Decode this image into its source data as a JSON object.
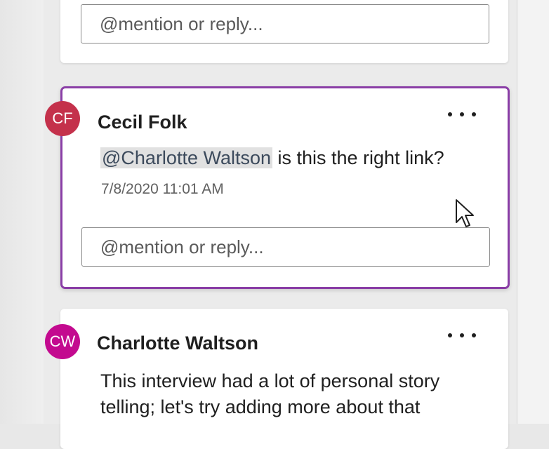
{
  "comments": [
    {
      "reply_placeholder": "@mention or reply..."
    },
    {
      "avatar_initials": "CF",
      "avatar_color": "#c4314b",
      "author": "Cecil Folk",
      "mention": "@Charlotte Waltson",
      "text": " is this the right link?",
      "timestamp": "7/8/2020 11:01 AM",
      "reply_placeholder": "@mention or reply...",
      "more_icon": "more-options-icon"
    },
    {
      "avatar_initials": "CW",
      "avatar_color": "#c30a8f",
      "author": "Charlotte Waltson",
      "text_line1": "This interview had a lot of personal story",
      "text_line2": "telling; let's try adding more about that",
      "more_icon": "more-options-icon"
    }
  ],
  "colors": {
    "active_border": "#8a3ea6"
  }
}
